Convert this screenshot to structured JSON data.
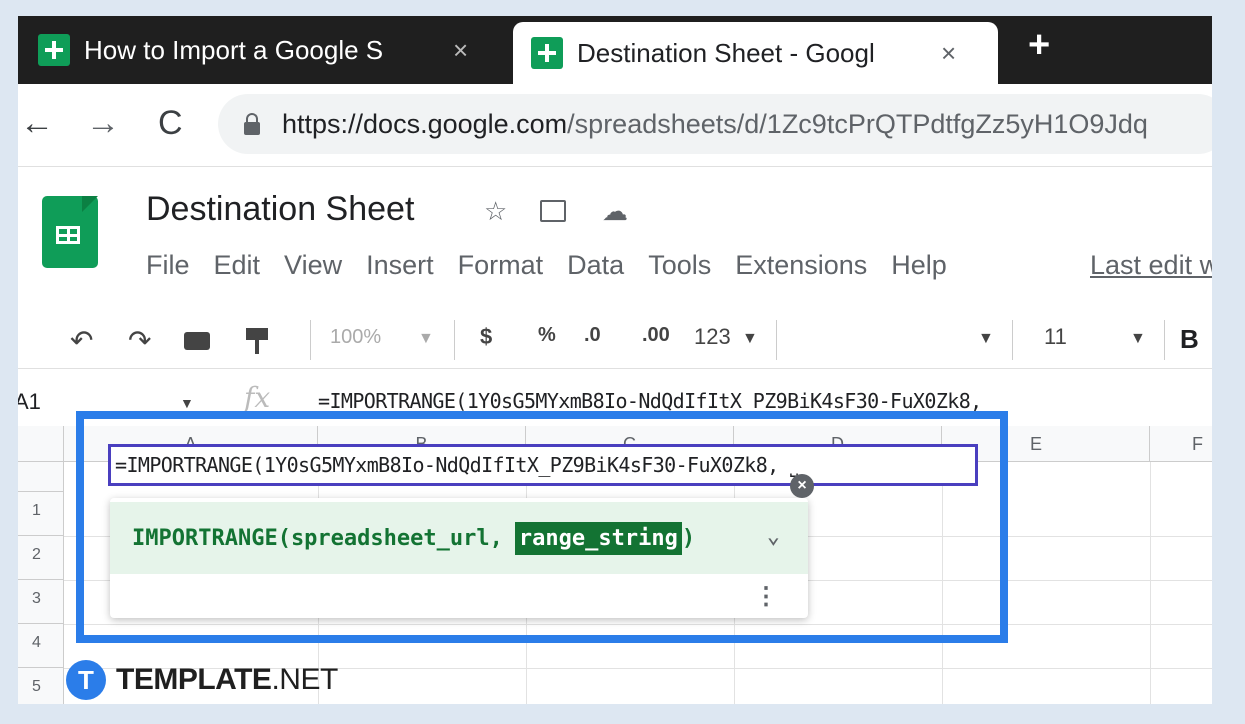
{
  "browser": {
    "tabs": [
      {
        "title": "How to Import a Google S"
      },
      {
        "title": "Destination Sheet - Googl"
      }
    ],
    "close_glyph": "×",
    "new_tab_glyph": "+",
    "url_domain": "https://docs.google.com",
    "url_path": "/spreadsheets/d/1Zc9tcPrQTPdtfgZz5yH1O9Jdq"
  },
  "doc": {
    "title": "Destination Sheet",
    "menu": [
      "File",
      "Edit",
      "View",
      "Insert",
      "Format",
      "Data",
      "Tools",
      "Extensions",
      "Help"
    ],
    "last_edit": "Last edit wa"
  },
  "toolbar": {
    "zoom": "100%",
    "currency": "$",
    "percent": "%",
    "decrease_decimal": ".0",
    "increase_decimal": ".00",
    "more_formats": "123",
    "font_size": "11",
    "bold": "B"
  },
  "formula_bar": {
    "cell_ref": "A1",
    "fx": "fx",
    "formula": "=IMPORTRANGE(1Y0sG5MYxmB8Io-NdQdIfItX_PZ9BiK4sF30-FuX0Zk8,"
  },
  "grid": {
    "columns": [
      "A",
      "B",
      "C",
      "D",
      "E",
      "F"
    ],
    "rows": [
      "1",
      "2",
      "3",
      "4",
      "5"
    ]
  },
  "editor": {
    "formula": "=IMPORTRANGE(1Y0sG5MYxmB8Io-NdQdIfItX_PZ9BiK4sF30-FuX0Zk8, ⎵"
  },
  "hint": {
    "function_prefix": "IMPORTRANGE(spreadsheet_url,",
    "active_arg": "range_string",
    "suffix": ")"
  },
  "watermark": {
    "logo_letter": "T",
    "brand": "TEMPLATE",
    "tld": ".NET"
  },
  "colors": {
    "highlight": "#2b7de9",
    "sheets_green": "#0f9d58",
    "hint_green": "#137333"
  }
}
